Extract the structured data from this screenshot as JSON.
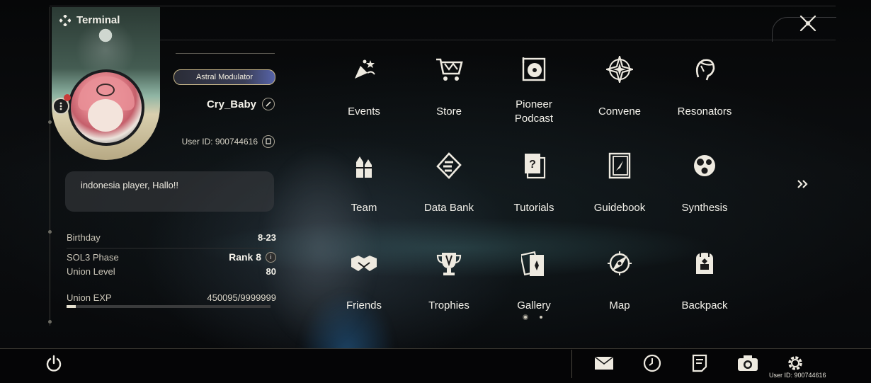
{
  "panel": {
    "title": "Terminal",
    "close_icon": "close-x-icon"
  },
  "profile": {
    "astral_badge": "Astral Modulator",
    "username": "Cry_Baby",
    "user_id_text": "User ID: 900744616",
    "bio": "indonesia player, Hallo!!"
  },
  "stats": {
    "birthday": {
      "label": "Birthday",
      "value": "8-23"
    },
    "phase": {
      "label": "SOL3 Phase",
      "value": "Rank 8"
    },
    "union_level": {
      "label": "Union Level",
      "value": "80"
    },
    "union_exp": {
      "label": "Union EXP",
      "value": "450095/9999999",
      "progress": 0.045
    }
  },
  "menu": [
    {
      "label": "Events",
      "icon": "events-icon"
    },
    {
      "label": "Store",
      "icon": "cart-icon"
    },
    {
      "label": "Pioneer\nPodcast",
      "icon": "podcast-icon"
    },
    {
      "label": "Convene",
      "icon": "compass-star-icon"
    },
    {
      "label": "Resonators",
      "icon": "resonator-head-icon"
    },
    {
      "label": "Team",
      "icon": "team-icon"
    },
    {
      "label": "Data Bank",
      "icon": "data-bank-icon"
    },
    {
      "label": "Tutorials",
      "icon": "tutorials-icon"
    },
    {
      "label": "Guidebook",
      "icon": "guidebook-icon"
    },
    {
      "label": "Synthesis",
      "icon": "synthesis-icon"
    },
    {
      "label": "Friends",
      "icon": "handshake-icon"
    },
    {
      "label": "Trophies",
      "icon": "trophy-icon"
    },
    {
      "label": "Gallery",
      "icon": "gallery-cards-icon"
    },
    {
      "label": "Map",
      "icon": "map-compass-icon"
    },
    {
      "label": "Backpack",
      "icon": "backpack-icon"
    }
  ],
  "pagination": {
    "pages": 2,
    "current": 1
  },
  "bottom_bar": {
    "power_icon": "power-icon",
    "icons": [
      "mail-icon",
      "clock-icon",
      "notes-icon",
      "camera-icon",
      "settings-gear-icon"
    ],
    "user_id_text": "User ID: 900744616"
  }
}
